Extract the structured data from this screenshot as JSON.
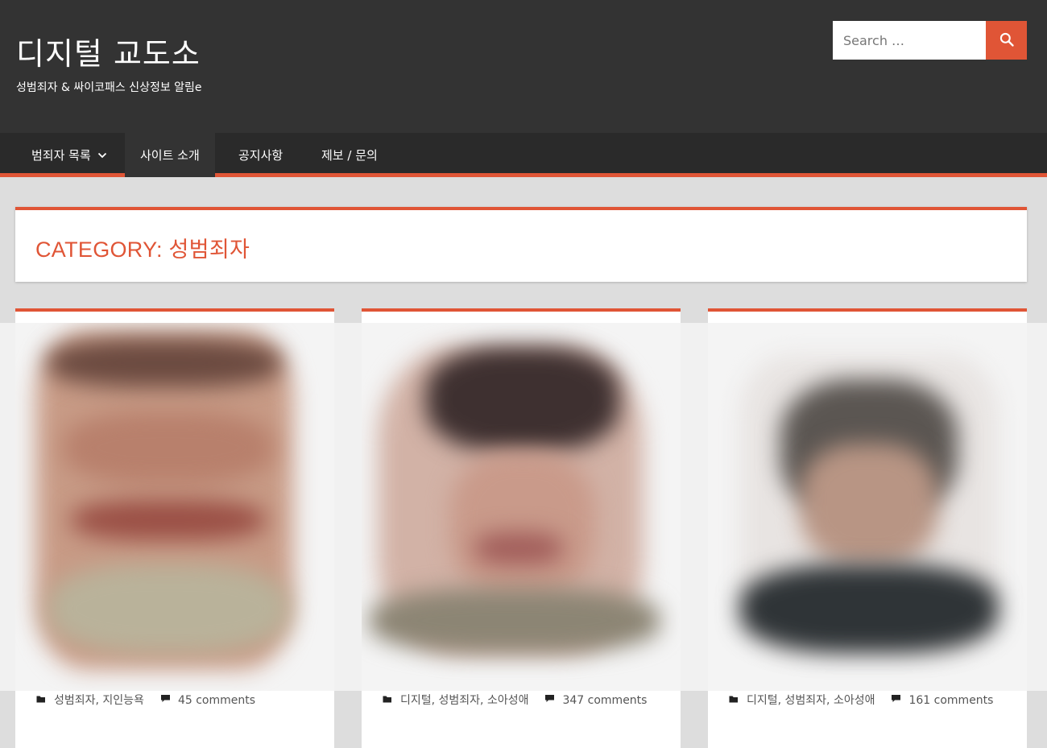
{
  "header": {
    "site_title": "디지털 교도소",
    "site_description": "성범죄자 & 싸이코패스 신상정보 알림e",
    "search": {
      "placeholder": "Search …",
      "button_icon": "search-icon"
    }
  },
  "nav": {
    "items": [
      {
        "label": "범죄자 목록",
        "has_dropdown": true
      },
      {
        "label": "사이트 소개",
        "active": true
      },
      {
        "label": "공지사항"
      },
      {
        "label": "제보 / 문의"
      }
    ]
  },
  "archive": {
    "title": "CATEGORY: 성범죄자"
  },
  "posts": [
    {
      "categories": "성범죄자, 지인능욕",
      "comments": "45 comments"
    },
    {
      "categories": "디지털, 성범죄자, 소아성애",
      "comments": "347 comments"
    },
    {
      "categories": "디지털, 성범죄자, 소아성애",
      "comments": "161 comments"
    }
  ],
  "colors": {
    "accent": "#e05536",
    "header_bg": "#333333",
    "nav_bg": "#2a2a2a",
    "page_bg": "#dddddd"
  }
}
